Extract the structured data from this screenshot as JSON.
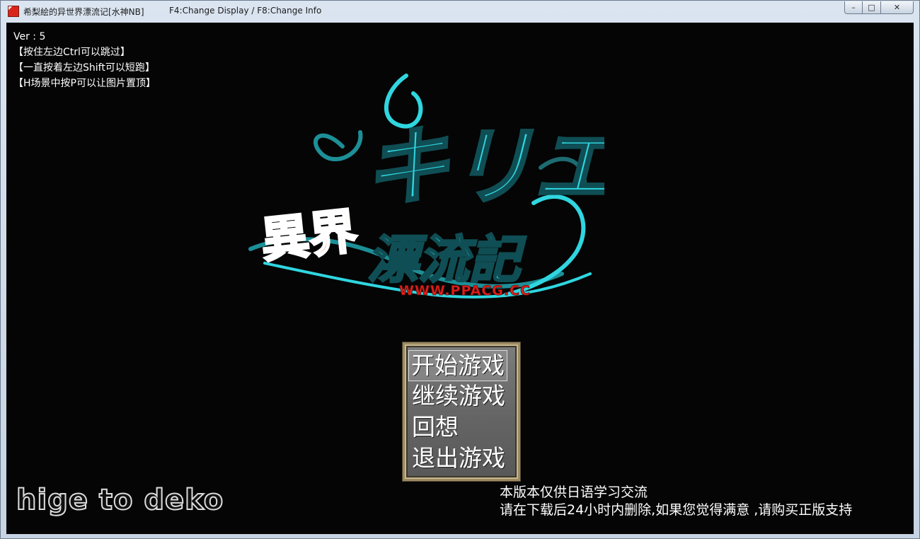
{
  "window": {
    "title": "希梨絵的异世界漂流记[水神NB]",
    "info": "F4:Change Display / F8:Change Info",
    "buttons": {
      "minimize": "–",
      "maximize": "□",
      "close": "✕"
    }
  },
  "hud": {
    "version": "Ver : 5",
    "hints": [
      "【按住左边Ctrl可以跳过】",
      "【一直按着左边Shift可以短跑】",
      "【H场景中按P可以让图片置顶】"
    ]
  },
  "logo": {
    "chars_top": "キリエの",
    "chars_red": "異界",
    "chars_bottom": "漂流記",
    "watermark": "WWW.PPACG.CC",
    "colors": {
      "cyan": "#2fd6e0",
      "teal_dark": "#1d6c72",
      "red": "#e0201a",
      "orange": "#f6a21d"
    }
  },
  "menu": {
    "items": [
      {
        "label": "开始游戏",
        "selected": true
      },
      {
        "label": "继续游戏",
        "selected": false
      },
      {
        "label": "回想",
        "selected": false
      },
      {
        "label": "退出游戏",
        "selected": false
      }
    ]
  },
  "credit": "hige to deko",
  "notice": {
    "line1": "本版本仅供日语学习交流",
    "line2": "请在下载后24小时内删除,如果您觉得满意 ,请购买正版支持"
  }
}
